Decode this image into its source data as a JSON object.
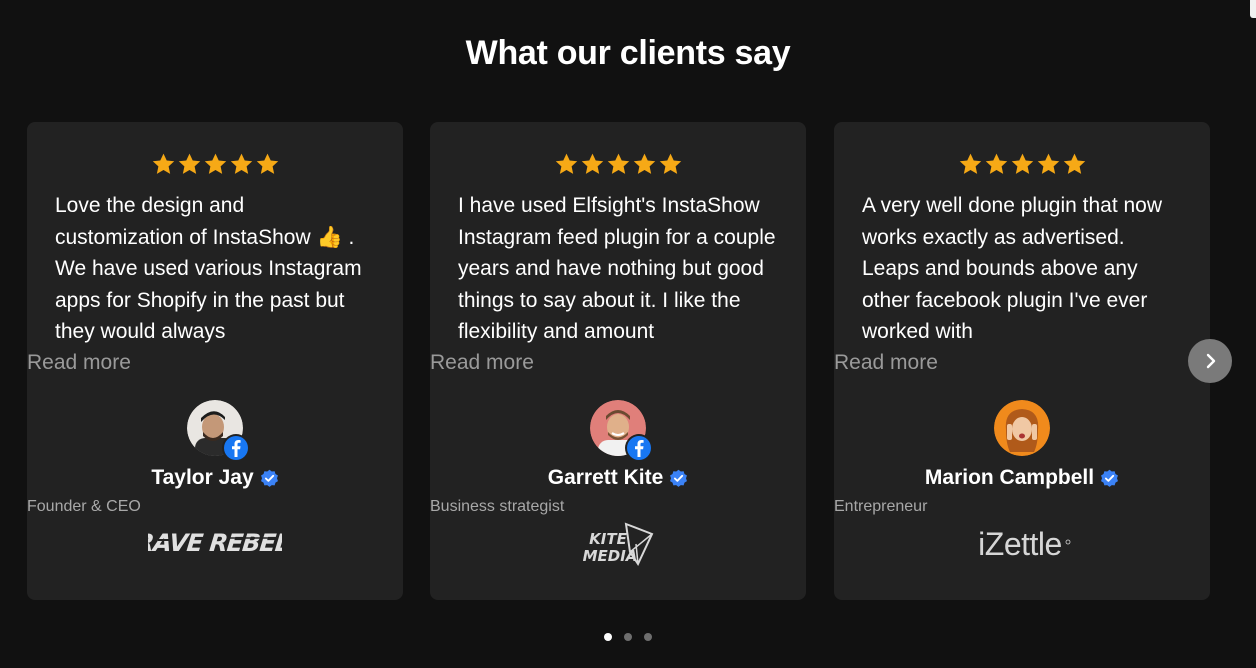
{
  "section": {
    "title": "What our clients say"
  },
  "colors": {
    "star": "#f6a916",
    "verified": "#3b82f6",
    "facebook": "#1877f2",
    "card_bg": "#222222"
  },
  "reviews": [
    {
      "rating": 5,
      "text": "Love the design and customization of InstaShow 👍 . We have used various Instagram apps for Shopify in the past but they would always",
      "read_more": "Read more",
      "name": "Taylor Jay",
      "role": "Founder & CEO",
      "company_logo": "RAVE REBEL",
      "source_icon": "facebook-icon",
      "verified": true
    },
    {
      "rating": 5,
      "text": "I have used Elfsight's InstaShow Instagram feed plugin for a couple years and have nothing but good things to say about it. I like the flexibility and amount",
      "read_more": "Read more",
      "name": "Garrett Kite",
      "role": "Business strategist",
      "company_logo": "KITE MEDIA",
      "source_icon": "facebook-icon",
      "verified": true
    },
    {
      "rating": 5,
      "text": "A very well done plugin that now works exactly as advertised. Leaps and bounds above any other facebook plugin I've ever worked with",
      "read_more": "Read more",
      "name": "Marion Campbell",
      "role": "Entrepreneur",
      "company_logo": "iZettle",
      "verified": true
    }
  ],
  "carousel": {
    "pages": 3,
    "active_page": 1,
    "next_icon": "chevron-right-icon"
  }
}
